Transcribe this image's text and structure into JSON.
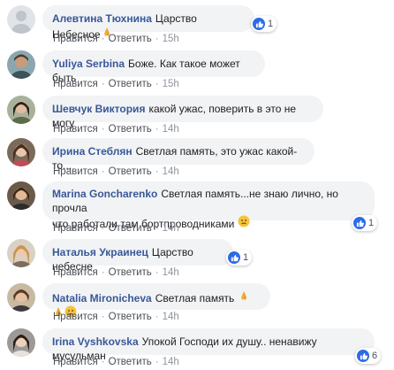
{
  "comments": [
    {
      "name": "Алевтина Тюхнина",
      "text": "Царство Небесное",
      "emoji": "pray",
      "reaction_count": "1",
      "like": "Нравится",
      "reply": "Ответить",
      "time": "15h"
    },
    {
      "name": "Yuliya Serbina",
      "text": "Боже. Как такое может быть",
      "like": "Нравится",
      "reply": "Ответить",
      "time": "15h"
    },
    {
      "name": "Шевчук Виктория",
      "text": "какой ужас, поверить в это не могу",
      "like": "Нравится",
      "reply": "Ответить",
      "time": "14h"
    },
    {
      "name": "Ирина Стеблян",
      "text": "Светлая память, это ужас какой-то...",
      "like": "Нравится",
      "reply": "Ответить",
      "time": "14h"
    },
    {
      "name": "Marina Goncharenko",
      "text": "Светлая память...не знаю лично, но прочла",
      "text2": "что работали там бортпроводниками",
      "reaction_count": "1",
      "like": "Нравится",
      "reply": "Ответить",
      "time": "14h"
    },
    {
      "name": "Наталья Украинец",
      "text": "Царство небесне",
      "reaction_count": "1",
      "like": "Нравится",
      "reply": "Ответить",
      "time": "14h"
    },
    {
      "name": "Natalia Mironicheva",
      "text": "Светлая память",
      "like": "Нравится",
      "reply": "Ответить",
      "time": "14h"
    },
    {
      "name": "Irina Vyshkovska",
      "text": "Упокой Господи их душу.. ненавижу мусульман",
      "reaction_count": "6",
      "like": "Нравится",
      "reply": "Ответить",
      "time": "14h"
    }
  ],
  "colors": {
    "name_link": "#385898",
    "bubble_bg": "#f2f3f5",
    "like_blue": "#2d6be6",
    "meta_gray": "#90949c"
  },
  "icons": {
    "like": "thumbs-up-icon",
    "pray": "praying-hands-icon",
    "sad": "crying-face-icon",
    "worried": "worried-face-icon"
  }
}
